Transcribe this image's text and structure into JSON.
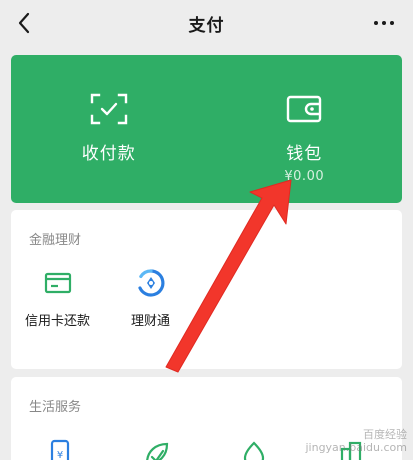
{
  "nav": {
    "title": "支付",
    "back_icon": "chevron-left-icon",
    "more_icon": "more-dots-icon"
  },
  "card": {
    "color": "#2fae66",
    "items": [
      {
        "label": "收付款",
        "icon": "scan-qr-icon"
      },
      {
        "label": "钱包",
        "balance": "¥0.00",
        "icon": "wallet-icon"
      }
    ]
  },
  "finance": {
    "title": "金融理财",
    "items": [
      {
        "label": "信用卡还款",
        "icon": "credit-card-icon"
      },
      {
        "label": "理财通",
        "icon": "wealth-icon"
      }
    ]
  },
  "life": {
    "title": "生活服务",
    "items": [
      {
        "icon": "phone-topup-icon"
      },
      {
        "icon": "leaf-check-icon"
      },
      {
        "icon": "water-drop-icon"
      },
      {
        "icon": "city-service-icon"
      }
    ]
  },
  "annotation": {
    "color": "#f2362b"
  },
  "watermark": {
    "line1": "百度经验",
    "line2": "jingyan.baidu.com"
  }
}
